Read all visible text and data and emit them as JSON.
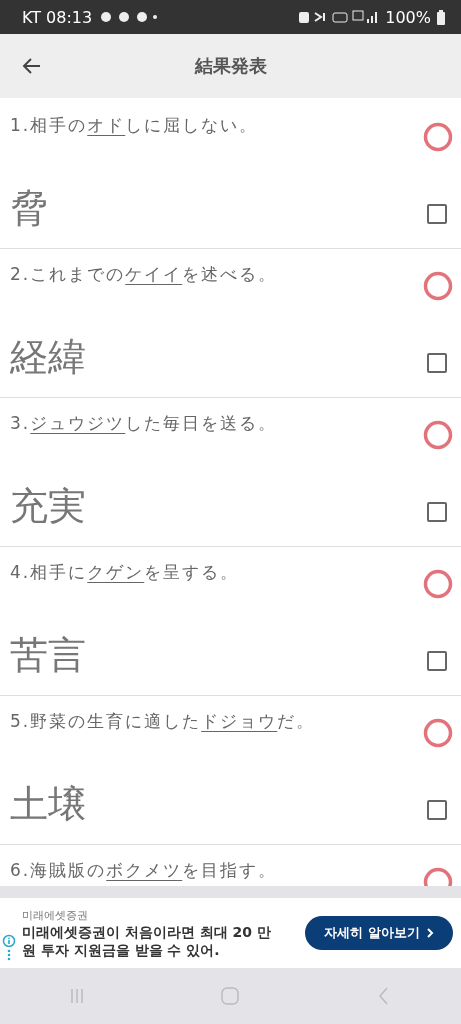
{
  "status_bar": {
    "carrier_time": "KT 08:13",
    "battery": "100%"
  },
  "app_bar": {
    "title": "結果発表"
  },
  "questions": [
    {
      "prefix": "1.相手の",
      "reading": "オド",
      "suffix": "しに屈しない。",
      "answer": "脅",
      "correct": true,
      "checked": false
    },
    {
      "prefix": "2.これまでの",
      "reading": "ケイイ",
      "suffix": "を述べる。",
      "answer": "経緯",
      "correct": true,
      "checked": false
    },
    {
      "prefix": "3.",
      "reading": "ジュウジツ",
      "suffix": "した毎日を送る。",
      "answer": "充実",
      "correct": true,
      "checked": false
    },
    {
      "prefix": "4.相手に",
      "reading": "クゲン",
      "suffix": "を呈する。",
      "answer": "苦言",
      "correct": true,
      "checked": false
    },
    {
      "prefix": "5.野菜の生育に適した",
      "reading": "ドジョウ",
      "suffix": "だ。",
      "answer": "土壌",
      "correct": true,
      "checked": false
    },
    {
      "prefix": "6.海賊版の",
      "reading": "ボクメツ",
      "suffix": "を目指す。",
      "correct": true
    }
  ],
  "ad": {
    "sponsor": "미래에셋증권",
    "text": "미래에셋증권이 처음이라면 최대 20 만원 투자 지원금을 받을 수 있어.",
    "button": "자세히 알아보기"
  }
}
